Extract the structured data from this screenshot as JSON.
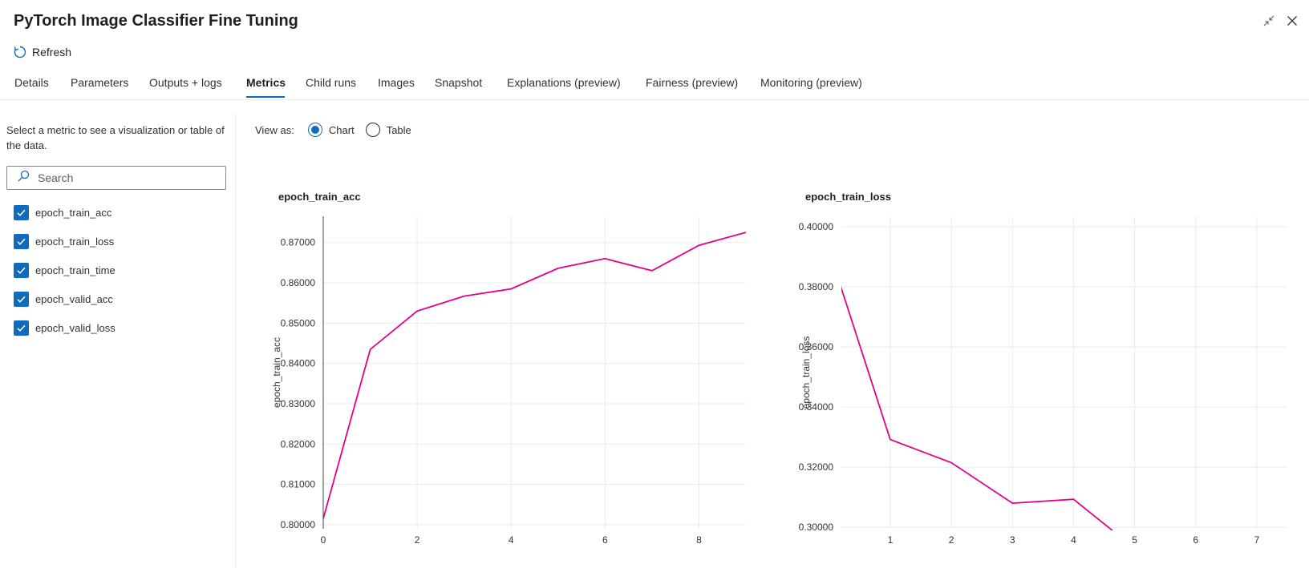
{
  "title": "PyTorch Image Classifier Fine Tuning",
  "window": {
    "collapse_icon": "collapse-arrows-icon",
    "close_icon": "close-icon"
  },
  "toolbar": {
    "refresh_label": "Refresh",
    "refresh_icon": "refresh-icon"
  },
  "tabs": [
    {
      "label": "Details"
    },
    {
      "label": "Parameters"
    },
    {
      "label": "Outputs + logs"
    },
    {
      "label": "Metrics",
      "active": true
    },
    {
      "label": "Child runs"
    },
    {
      "label": "Images"
    },
    {
      "label": "Snapshot"
    },
    {
      "label": "Explanations (preview)"
    },
    {
      "label": "Fairness (preview)"
    },
    {
      "label": "Monitoring (preview)"
    }
  ],
  "sidebar": {
    "description": "Select a metric to see a visualization or table of the data.",
    "search_placeholder": "Search",
    "metrics": [
      {
        "label": "epoch_train_acc",
        "checked": true
      },
      {
        "label": "epoch_train_loss",
        "checked": true
      },
      {
        "label": "epoch_train_time",
        "checked": true
      },
      {
        "label": "epoch_valid_acc",
        "checked": true
      },
      {
        "label": "epoch_valid_loss",
        "checked": true
      }
    ]
  },
  "view": {
    "label": "View as:",
    "options": [
      "Chart",
      "Table"
    ],
    "selected": "Chart"
  },
  "colors": {
    "accent": "#0f6cbd",
    "line": "#e3008c",
    "grid": "#ebebeb"
  },
  "chart_data": [
    {
      "type": "line",
      "title": "epoch_train_acc",
      "xlabel": "",
      "ylabel": "epoch_train_acc",
      "x": [
        0,
        1,
        2,
        3,
        4,
        5,
        6,
        7,
        8,
        9
      ],
      "series": [
        {
          "values": [
            0.8015,
            0.8435,
            0.853,
            0.8567,
            0.8585,
            0.8636,
            0.866,
            0.863,
            0.8693,
            0.8725
          ]
        }
      ],
      "xlim": [
        0,
        9
      ],
      "ylim": [
        0.799,
        0.8765
      ],
      "xticks": [
        0,
        2,
        4,
        6,
        8
      ],
      "yticks": [
        0.8,
        0.81,
        0.82,
        0.83,
        0.84,
        0.85,
        0.86,
        0.87
      ],
      "ytick_labels": [
        "0.80000",
        "0.81000",
        "0.82000",
        "0.83000",
        "0.84000",
        "0.85000",
        "0.86000",
        "0.87000"
      ],
      "grid": true
    },
    {
      "type": "line",
      "title": "epoch_train_loss",
      "xlabel": "",
      "ylabel": "epoch_train_loss",
      "x": [
        0,
        1,
        2,
        3,
        4,
        5
      ],
      "series": [
        {
          "values": [
            0.392,
            0.3292,
            0.3215,
            0.308,
            0.3093,
            0.293
          ]
        }
      ],
      "xlim": [
        0.2,
        7.5
      ],
      "ylim": [
        0.2995,
        0.4035
      ],
      "xticks": [
        1,
        2,
        3,
        4,
        5,
        6,
        7
      ],
      "yticks": [
        0.3,
        0.32,
        0.34,
        0.36,
        0.38,
        0.4
      ],
      "ytick_labels": [
        "0.30000",
        "0.32000",
        "0.34000",
        "0.36000",
        "0.38000",
        "0.40000"
      ],
      "grid": true
    }
  ]
}
